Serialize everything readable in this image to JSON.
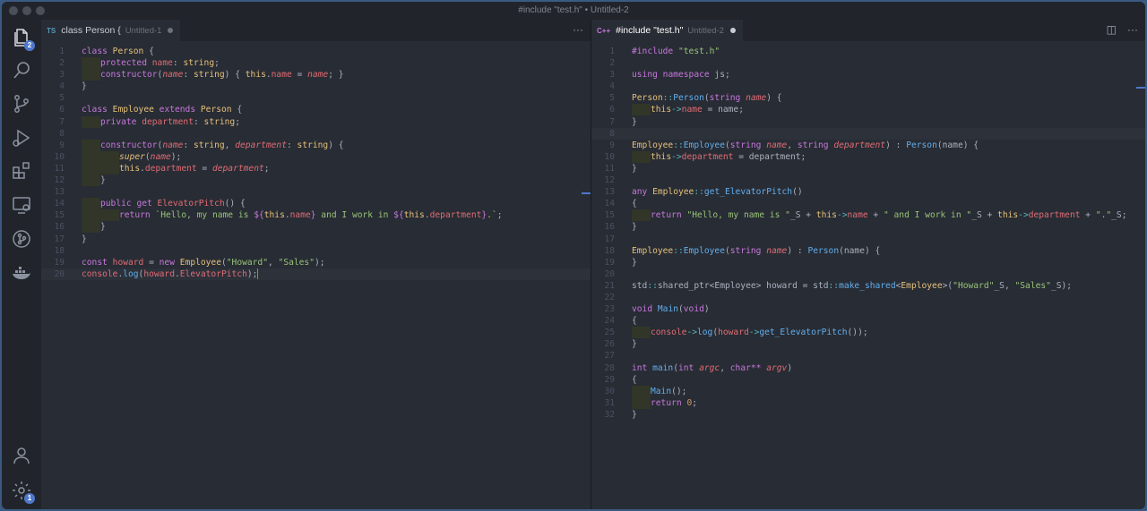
{
  "window": {
    "title": "#include \"test.h\" • Untitled-2"
  },
  "activity_bar": {
    "explorer_badge": "2",
    "settings_badge": "1"
  },
  "left_editor": {
    "tab": {
      "lang_badge": "TS",
      "name": "class Person {",
      "description": "Untitled-1"
    },
    "actions": {
      "more": "···"
    },
    "lines": [
      "1",
      "2",
      "3",
      "4",
      "5",
      "6",
      "7",
      "8",
      "9",
      "10",
      "11",
      "12",
      "13",
      "14",
      "15",
      "16",
      "17",
      "18",
      "19",
      "20"
    ]
  },
  "right_editor": {
    "tab": {
      "lang_badge": "C++",
      "name": "#include \"test.h\"",
      "description": "Untitled-2"
    },
    "actions": {
      "split": "◫",
      "more": "···"
    },
    "lines": [
      "1",
      "2",
      "3",
      "4",
      "5",
      "6",
      "7",
      "8",
      "9",
      "10",
      "11",
      "12",
      "13",
      "14",
      "15",
      "16",
      "17",
      "18",
      "19",
      "20",
      "21",
      "22",
      "23",
      "24",
      "25",
      "26",
      "27",
      "28",
      "29",
      "30",
      "31",
      "32"
    ]
  },
  "colors": {
    "background": "#282c34",
    "sidebar": "#21252b",
    "accent": "#4d78cc",
    "modified_dot": "#c8ccd4",
    "ts_badge": "#519aba",
    "cpp_badge": "#c678dd"
  },
  "icons": [
    "explorer-icon",
    "search-icon",
    "source-control-icon",
    "debug-icon",
    "extensions-icon",
    "remote-explorer-icon",
    "git-graph-icon",
    "docker-icon",
    "account-icon",
    "settings-gear-icon"
  ]
}
